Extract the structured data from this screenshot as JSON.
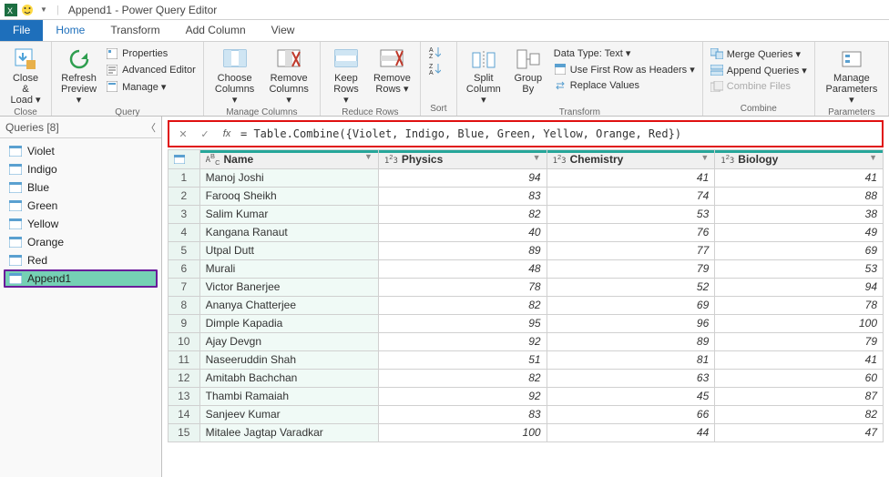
{
  "title": "Append1 - Power Query Editor",
  "tabs": {
    "file": "File",
    "home": "Home",
    "transform": "Transform",
    "addcol": "Add Column",
    "view": "View"
  },
  "ribbon": {
    "close": {
      "label": "Close &\nLoad ▾",
      "group": "Close"
    },
    "query": {
      "refresh": "Refresh\nPreview ▾",
      "properties": "Properties",
      "advanced": "Advanced Editor",
      "manage": "Manage ▾",
      "group": "Query"
    },
    "cols": {
      "choose": "Choose\nColumns ▾",
      "remove": "Remove\nColumns ▾",
      "group": "Manage Columns"
    },
    "rows": {
      "keep": "Keep\nRows ▾",
      "remove": "Remove\nRows ▾",
      "group": "Reduce Rows"
    },
    "sort": {
      "group": "Sort"
    },
    "transform": {
      "split": "Split\nColumn ▾",
      "groupby": "Group\nBy",
      "datatype": "Data Type: Text ▾",
      "firstrow": "Use First Row as Headers ▾",
      "replace": "Replace Values",
      "group": "Transform"
    },
    "combine": {
      "merge": "Merge Queries ▾",
      "append": "Append Queries ▾",
      "combine": "Combine Files",
      "group": "Combine"
    },
    "params": {
      "label": "Manage\nParameters ▾",
      "group": "Parameters"
    }
  },
  "queries": {
    "header": "Queries [8]",
    "items": [
      "Violet",
      "Indigo",
      "Blue",
      "Green",
      "Yellow",
      "Orange",
      "Red",
      "Append1"
    ],
    "selected": 7
  },
  "formula": "= Table.Combine({Violet, Indigo, Blue, Green, Yellow, Orange, Red})",
  "columns": [
    {
      "type": "ABC",
      "label": "Name"
    },
    {
      "type": "123",
      "label": "Physics"
    },
    {
      "type": "123",
      "label": "Chemistry"
    },
    {
      "type": "123",
      "label": "Biology"
    }
  ],
  "rows": [
    {
      "n": 1,
      "name": "Manoj Joshi",
      "p": 94,
      "c": 41,
      "b": 41
    },
    {
      "n": 2,
      "name": "Farooq Sheikh",
      "p": 83,
      "c": 74,
      "b": 88
    },
    {
      "n": 3,
      "name": "Salim Kumar",
      "p": 82,
      "c": 53,
      "b": 38
    },
    {
      "n": 4,
      "name": "Kangana Ranaut",
      "p": 40,
      "c": 76,
      "b": 49
    },
    {
      "n": 5,
      "name": "Utpal Dutt",
      "p": 89,
      "c": 77,
      "b": 69
    },
    {
      "n": 6,
      "name": "Murali",
      "p": 48,
      "c": 79,
      "b": 53
    },
    {
      "n": 7,
      "name": "Victor Banerjee",
      "p": 78,
      "c": 52,
      "b": 94
    },
    {
      "n": 8,
      "name": "Ananya Chatterjee",
      "p": 82,
      "c": 69,
      "b": 78
    },
    {
      "n": 9,
      "name": "Dimple Kapadia",
      "p": 95,
      "c": 96,
      "b": 100
    },
    {
      "n": 10,
      "name": "Ajay Devgn",
      "p": 92,
      "c": 89,
      "b": 79
    },
    {
      "n": 11,
      "name": "Naseeruddin Shah",
      "p": 51,
      "c": 81,
      "b": 41
    },
    {
      "n": 12,
      "name": "Amitabh Bachchan",
      "p": 82,
      "c": 63,
      "b": 60
    },
    {
      "n": 13,
      "name": "Thambi Ramaiah",
      "p": 92,
      "c": 45,
      "b": 87
    },
    {
      "n": 14,
      "name": "Sanjeev Kumar",
      "p": 83,
      "c": 66,
      "b": 82
    },
    {
      "n": 15,
      "name": "Mitalee Jagtap Varadkar",
      "p": 100,
      "c": 44,
      "b": 47
    }
  ]
}
